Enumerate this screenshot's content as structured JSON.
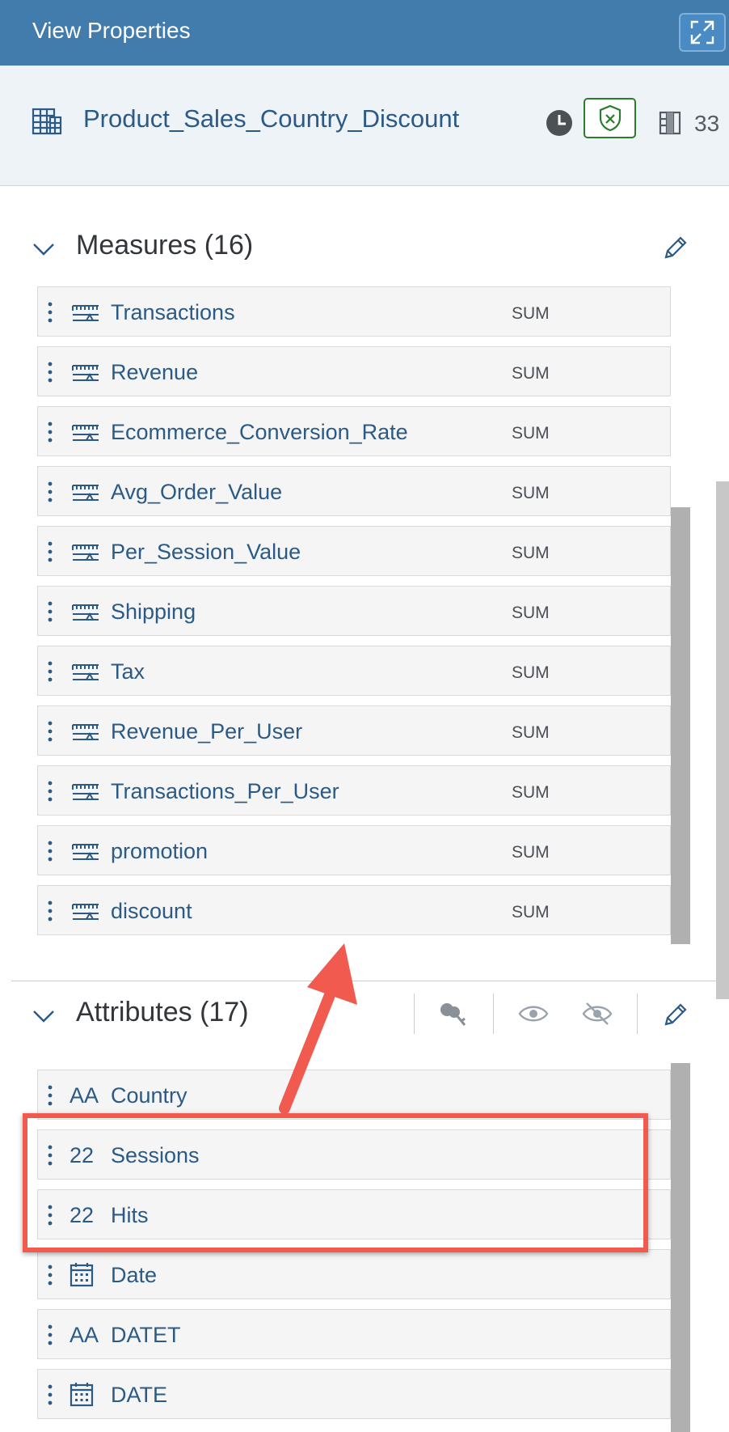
{
  "header": {
    "title": "View Properties",
    "expand_icon": "expand-icon"
  },
  "view": {
    "name": "Product_Sales_Country_Discount",
    "column_count": "33",
    "status_icons": [
      "clock-icon",
      "shield-check-icon",
      "columns-icon"
    ]
  },
  "measures": {
    "title": "Measures (16)",
    "items": [
      {
        "label": "Transactions",
        "agg": "SUM"
      },
      {
        "label": "Revenue",
        "agg": "SUM"
      },
      {
        "label": "Ecommerce_Conversion_Rate",
        "agg": "SUM"
      },
      {
        "label": "Avg_Order_Value",
        "agg": "SUM"
      },
      {
        "label": "Per_Session_Value",
        "agg": "SUM"
      },
      {
        "label": "Shipping",
        "agg": "SUM"
      },
      {
        "label": "Tax",
        "agg": "SUM"
      },
      {
        "label": "Revenue_Per_User",
        "agg": "SUM"
      },
      {
        "label": "Transactions_Per_User",
        "agg": "SUM"
      },
      {
        "label": "promotion",
        "agg": "SUM"
      },
      {
        "label": "discount",
        "agg": "SUM"
      }
    ]
  },
  "attributes": {
    "title": "Attributes (17)",
    "items": [
      {
        "label": "Country",
        "type": "string",
        "type_glyph": "AA"
      },
      {
        "label": "Sessions",
        "type": "number",
        "type_glyph": "22"
      },
      {
        "label": "Hits",
        "type": "number",
        "type_glyph": "22"
      },
      {
        "label": "Date",
        "type": "date",
        "type_glyph": ""
      },
      {
        "label": "DATET",
        "type": "string",
        "type_glyph": "AA"
      },
      {
        "label": "DATE",
        "type": "date",
        "type_glyph": ""
      }
    ]
  },
  "colors": {
    "header_bg": "#427cac",
    "accent_text": "#2a5a85",
    "annotation": "#f05a4f",
    "shield": "#2b7d2b"
  }
}
